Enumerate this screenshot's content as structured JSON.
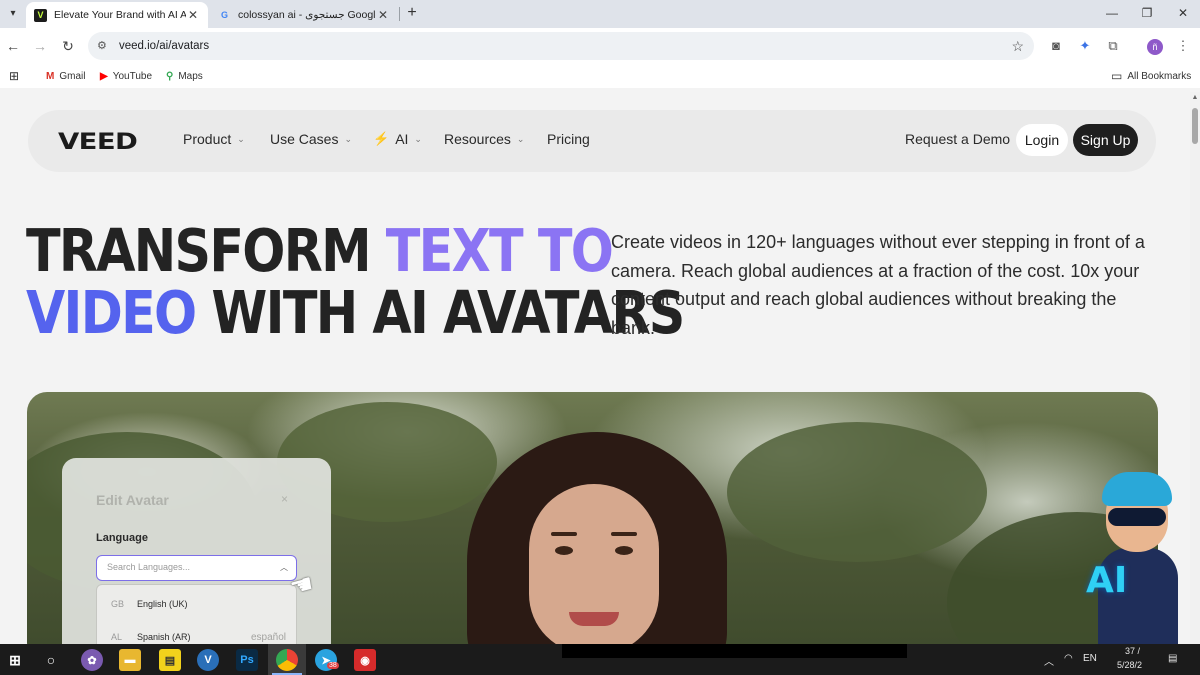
{
  "browser": {
    "tabs": [
      {
        "title": "Elevate Your Brand with AI Avat",
        "favicon": "veed-logo-icon",
        "active": true
      },
      {
        "title": "colossyan ai - جستجوی Google",
        "favicon": "google-g-icon",
        "active": false
      }
    ],
    "url": "veed.io/ai/avatars",
    "bookmarks": [
      {
        "label": "Gmail",
        "icon": "gmail-icon"
      },
      {
        "label": "YouTube",
        "icon": "youtube-icon"
      },
      {
        "label": "Maps",
        "icon": "maps-icon"
      }
    ],
    "all_bookmarks": "All Bookmarks",
    "profile_initial": "ñ"
  },
  "nav": {
    "logo": "VEED",
    "items": [
      {
        "label": "Product",
        "has_menu": true
      },
      {
        "label": "Use Cases",
        "has_menu": true
      },
      {
        "label": "AI",
        "has_menu": true,
        "icon": "lightning-bolt-icon"
      },
      {
        "label": "Resources",
        "has_menu": true
      },
      {
        "label": "Pricing",
        "has_menu": false
      }
    ],
    "request_demo": "Request a Demo",
    "login": "Login",
    "signup": "Sign Up"
  },
  "hero": {
    "headline_part1": "TRANSFORM ",
    "headline_part2": "TEXT TO",
    "headline_part3": "VIDEO",
    "headline_part4": " WITH AI AVATARS",
    "subcopy": "Create videos in 120+ languages without ever stepping in front of a camera. Reach global audiences at a fraction of the cost. 10x your content output and reach global audiences without breaking the bank.",
    "accent_light": "#8b74f3",
    "accent_blue": "#5563ee"
  },
  "edit_avatar": {
    "title": "Edit Avatar",
    "close": "×",
    "language_label": "Language",
    "search_placeholder": "Search Languages...",
    "languages": [
      {
        "code": "GB",
        "name": "English (UK)",
        "native": ""
      },
      {
        "code": "AL",
        "name": "Spanish (AR)",
        "native": "español"
      }
    ]
  },
  "mascot": {
    "badge": "AI"
  },
  "taskbar": {
    "apps": [
      "start-icon",
      "search-icon",
      "app-icon",
      "file-explorer-icon",
      "sticky-notes-icon",
      "veed-app-icon",
      "photoshop-icon",
      "chrome-icon",
      "telegram-icon",
      "red-app-icon"
    ],
    "telegram_badge": "38",
    "photoshop_label": "Ps",
    "language": "EN",
    "clock_partial": "37 /",
    "date_partial": "5/28/2"
  }
}
